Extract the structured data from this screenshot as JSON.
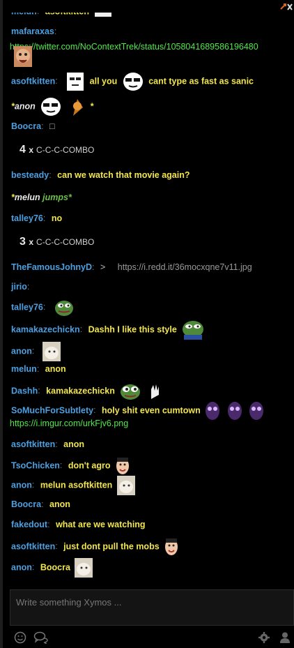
{
  "header": {
    "popout_icon": "popout-close-icon"
  },
  "messages": {
    "m0": {
      "user": "melun",
      "text": "asoftkitten"
    },
    "m1": {
      "user": "mafaraxas",
      "link": "https://twitter.com/NoContextTrek/status/1058041689586196480"
    },
    "m2": {
      "user": "asoftkitten",
      "t1": "all you",
      "t2": "cant type as fast as sanic"
    },
    "m3": {
      "name": "anon",
      "star": "*"
    },
    "m4": {
      "user": "Boocra",
      "text": "□"
    },
    "m5": {
      "count": "4",
      "x": "x",
      "label": "C-C-C-COMBO"
    },
    "m6": {
      "user": "besteady",
      "text": "can we watch that movie again?"
    },
    "m7": {
      "star": "*",
      "name": "melun",
      "text": "jumps*"
    },
    "m8": {
      "user": "talley76",
      "text": "no"
    },
    "m9": {
      "count": "3",
      "x": "x",
      "label": "C-C-C-COMBO"
    },
    "m10": {
      "user": "TheFamousJohnyD",
      "text": ">",
      "embed": "https://i.redd.it/36mocxqne7v11.jpg"
    },
    "m11": {
      "user": "jirio"
    },
    "m12": {
      "user": "talley76"
    },
    "m13": {
      "user": "kamakazechickn",
      "text": "Dashh I like this style"
    },
    "m14": {
      "user": "anon"
    },
    "m15": {
      "user": "melun",
      "text": "anon"
    },
    "m16": {
      "user": "Dashh",
      "text": "kamakazechickn"
    },
    "m17": {
      "user": "SoMuchForSubtlety",
      "text": "holy shit even cumtown",
      "link": "https://i.imgur.com/urkFjv6.png"
    },
    "m18": {
      "user": "asoftkitten",
      "text": "anon"
    },
    "m19": {
      "user": "TsoChicken",
      "text": "don't agro"
    },
    "m20": {
      "user": "anon",
      "text": "melun asoftkitten"
    },
    "m21": {
      "user": "Boocra",
      "text": "anon"
    },
    "m22": {
      "user": "fakedout",
      "text": "what are we watching"
    },
    "m23": {
      "user": "asoftkitten",
      "text": "just dont pull the mobs"
    },
    "m24": {
      "user": "anon",
      "text": "Boocra"
    }
  },
  "composer": {
    "placeholder": "Write something Xymos ..."
  },
  "bottom": {
    "emote_icon": "smiley-icon",
    "whisper_icon": "chat-bubbles-icon",
    "settings_icon": "gear-icon",
    "users_icon": "user-icon"
  },
  "colors": {
    "username": "#4c9fe0",
    "message": "#f2e64c",
    "link": "#50e84a",
    "background": "#000000"
  }
}
